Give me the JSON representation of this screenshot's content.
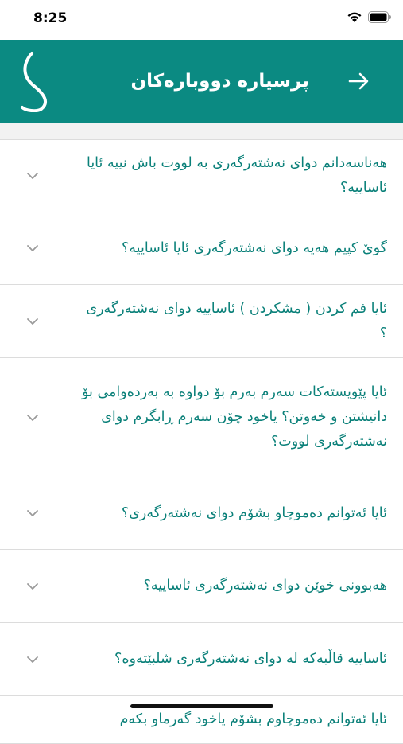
{
  "status_bar": {
    "time": "8:25"
  },
  "header": {
    "title": "پرسیارە دووبارەکان",
    "logo_icon": "app-logo-curve-icon",
    "back_icon": "arrow-right-icon",
    "bg_color": "#0b8a82"
  },
  "faq": {
    "items": [
      {
        "question": "هەناسەدانم دوای نەشتەرگەری بە لووت باش نییە ئایا ئاساییە؟"
      },
      {
        "question": "گوێ کپیم هەیە دوای نەشتەرگەری ئایا ئاساییە؟"
      },
      {
        "question": "ئایا فم کردن ( مشکردن ) ئاساییە دوای نەشتەرگەری ؟"
      },
      {
        "question": "ئایا پێویستەکات سەرم بەرم بۆ دواوە بە بەردەوامی بۆ دانیشتن و خەوتن؟ یاخود چۆن سەرم ڕابگرم دوای نەشتەرگەری لووت؟"
      },
      {
        "question": "ئایا ئەتوانم دەموچاو بشۆم دوای نەشتەرگەری؟"
      },
      {
        "question": "هەبوونی خوێن دوای نەشتەرگەری ئاساییە؟"
      },
      {
        "question": "ئاساییە قاڵبەکە لە دوای نەشتەرگەری شلبێتەوە؟"
      },
      {
        "question": "ئایا ئەتوانم دەموچاوم بشۆم یاخود گەرماو بکەم"
      }
    ]
  }
}
